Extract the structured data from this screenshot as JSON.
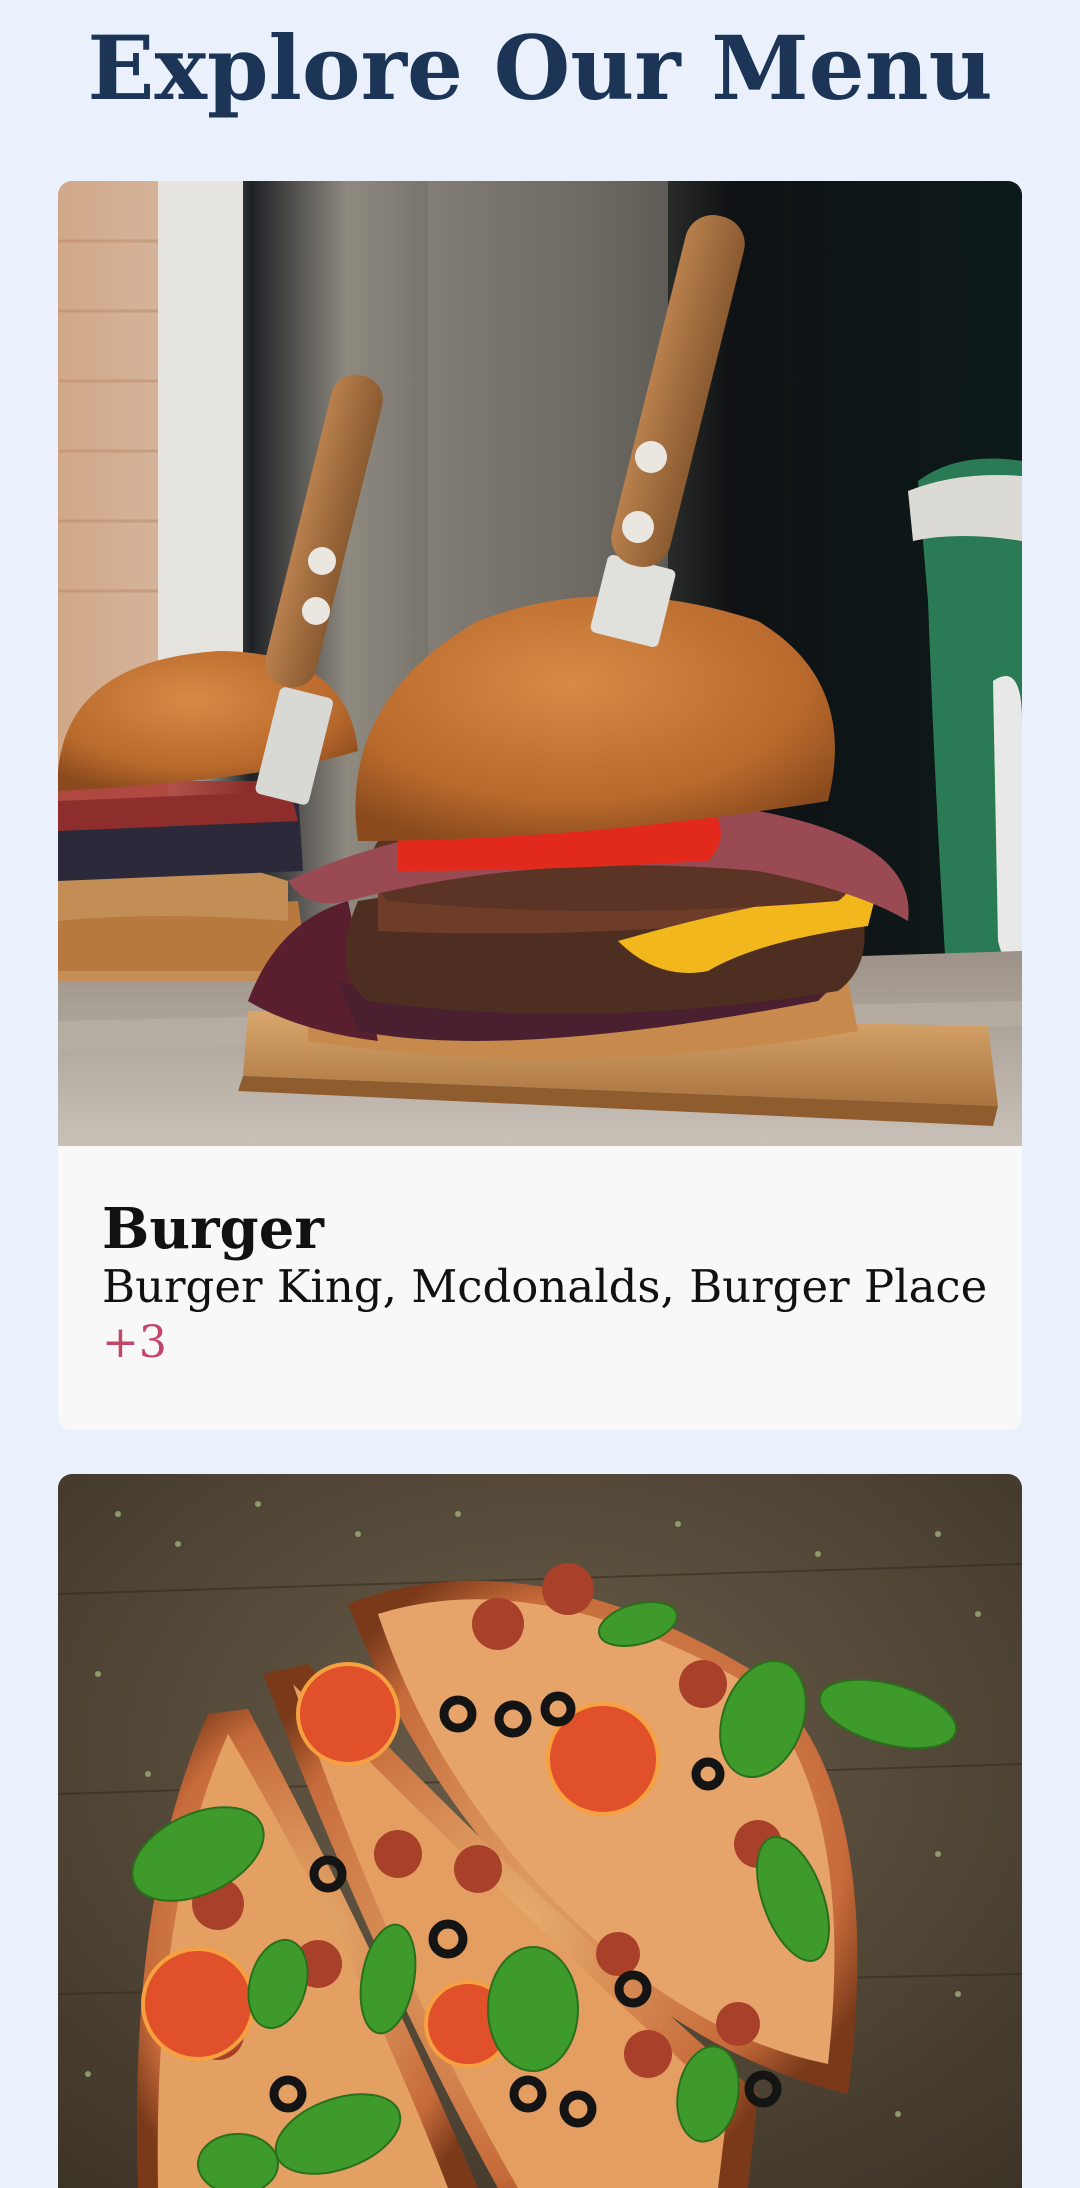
{
  "page": {
    "title": "Explore Our Menu",
    "background": "#eaf1fd",
    "title_color": "#1c3557",
    "accent_color": "#c2456a"
  },
  "cards": [
    {
      "image": "burger-photo",
      "title": "Burger",
      "places": "Burger King, Mcdonalds, Burger Place",
      "more": "+3"
    },
    {
      "image": "pizza-photo"
    }
  ]
}
